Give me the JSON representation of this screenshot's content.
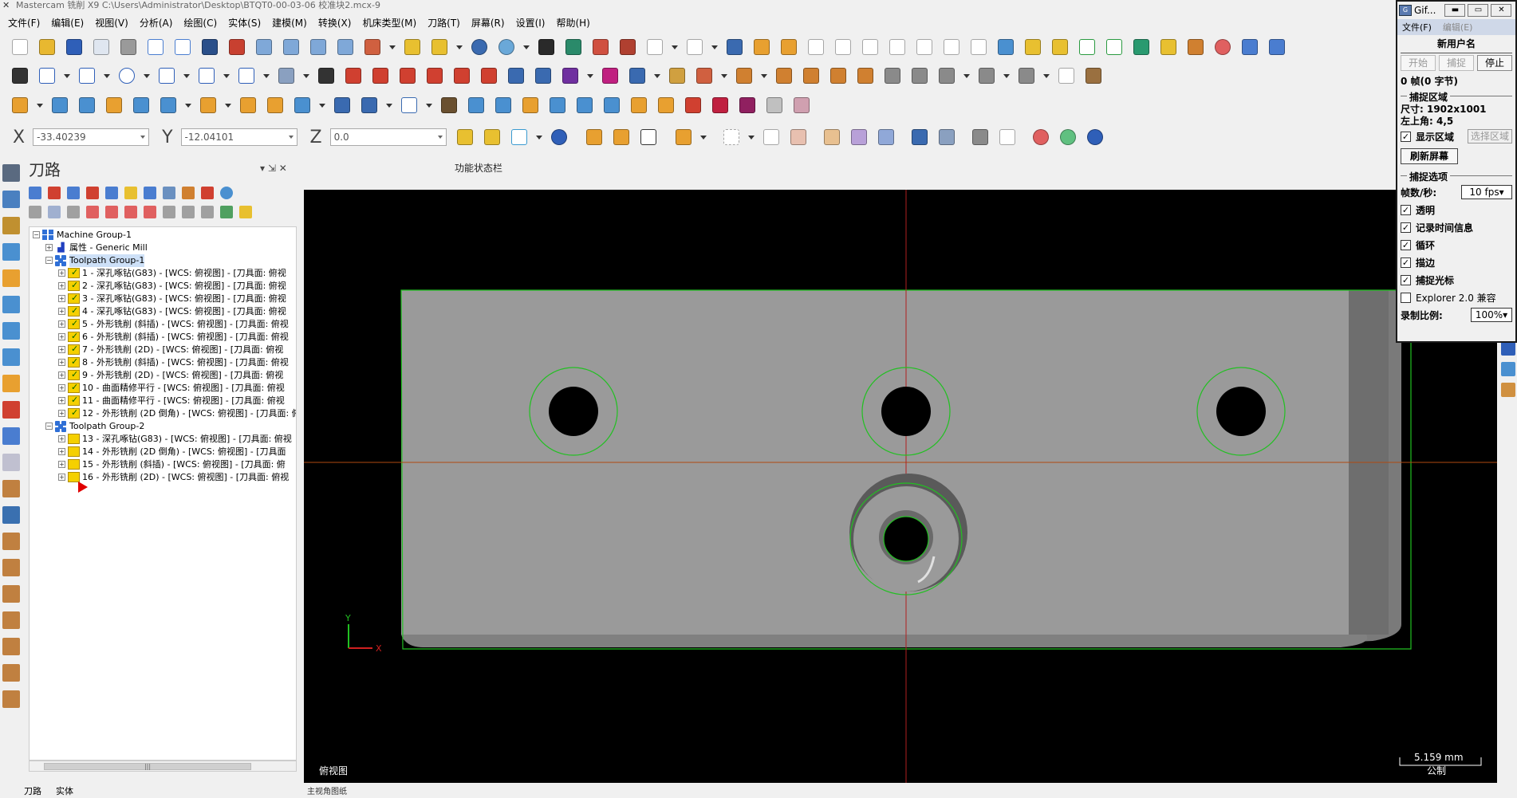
{
  "titlebar": {
    "text": "Mastercam 铣削 X9  C:\\Users\\Administrator\\Desktop\\BTQT0-00-03-06 校准块2.mcx-9"
  },
  "menu": [
    "文件(F)",
    "编辑(E)",
    "视图(V)",
    "分析(A)",
    "绘图(C)",
    "实体(S)",
    "建模(M)",
    "转换(X)",
    "机床类型(M)",
    "刀路(T)",
    "屏幕(R)",
    "设置(I)",
    "帮助(H)"
  ],
  "coords": {
    "x_label": "X",
    "x_value": "-33.40239",
    "y_label": "Y",
    "y_value": "-12.04101",
    "z_label": "Z",
    "z_value": "0.0"
  },
  "panel": {
    "title": "刀路",
    "pin": "▾ ⇲ ✕",
    "tree": {
      "machine_group": "Machine Group-1",
      "properties": "属性 - Generic Mill",
      "group1": "Toolpath Group-1",
      "group1_ops": [
        "1 - 深孔啄钻(G83) - [WCS: 俯视图] - [刀具面: 俯视",
        "2 - 深孔啄钻(G83) - [WCS: 俯视图] - [刀具面: 俯视",
        "3 - 深孔啄钻(G83) - [WCS: 俯视图] - [刀具面: 俯视",
        "4 - 深孔啄钻(G83) - [WCS: 俯视图] - [刀具面: 俯视",
        "5 - 外形铣削 (斜插) - [WCS: 俯视图] - [刀具面: 俯视",
        "6 - 外形铣削 (斜插) - [WCS: 俯视图] - [刀具面: 俯视",
        "7 - 外形铣削 (2D) - [WCS: 俯视图] - [刀具面: 俯视",
        "8 - 外形铣削 (斜插) - [WCS: 俯视图] - [刀具面: 俯视",
        "9 - 外形铣削 (2D) - [WCS: 俯视图] - [刀具面: 俯视",
        "10 - 曲面精修平行 - [WCS: 俯视图] - [刀具面: 俯视",
        "11 - 曲面精修平行 - [WCS: 俯视图] - [刀具面: 俯视",
        "12 - 外形铣削 (2D 倒角) - [WCS: 俯视图] - [刀具面: 俯视"
      ],
      "group2": "Toolpath Group-2",
      "group2_ops": [
        "13 - 深孔啄钻(G83) - [WCS: 俯视图] - [刀具面: 俯视",
        "14 - 外形铣削 (2D 倒角) - [WCS: 俯视图] - [刀具面",
        "15 - 外形铣削 (斜插) - [WCS: 俯视图] - [刀具面: 俯",
        "16 - 外形铣削 (2D) - [WCS: 俯视图] - [刀具面: 俯视"
      ]
    },
    "scroll_grip": "|||",
    "tabs": [
      "刀路",
      "实体"
    ]
  },
  "func_status": "功能状态栏",
  "viewport": {
    "view_name": "俯视图",
    "scale": "5.159 mm",
    "unit": "公制",
    "axis_y": "Y",
    "axis_x": "X"
  },
  "bottom_strip": "主视角图纸",
  "gif": {
    "title": "Gif...",
    "btn_min": "▬",
    "btn_max": "▭",
    "btn_close": "✕",
    "menu_file": "文件(F)",
    "menu_edit": "编辑(E)",
    "new_user": "新用户名",
    "btn_start": "开始",
    "btn_capture": "捕捉",
    "btn_stop": "停止",
    "frames": "0 帧(0 字节)",
    "sec_area": "捕捉区域",
    "size": "尺寸: 1902x1001",
    "topleft": "左上角: 4,5",
    "show_area": "显示区域",
    "select_area": "选择区域",
    "refresh": "刷新屏幕",
    "sec_options": "捕捉选项",
    "fps_label": "帧数/秒:",
    "fps_value": "10 fps▾",
    "opt_transparent": "透明",
    "opt_timestamp": "记录时间信息",
    "opt_loop": "循环",
    "opt_border": "描边",
    "opt_cursor": "捕捉光标",
    "opt_explorer": "Explorer 2.0 兼容",
    "scale_label": "录制比例:",
    "scale_value": "100%▾"
  }
}
